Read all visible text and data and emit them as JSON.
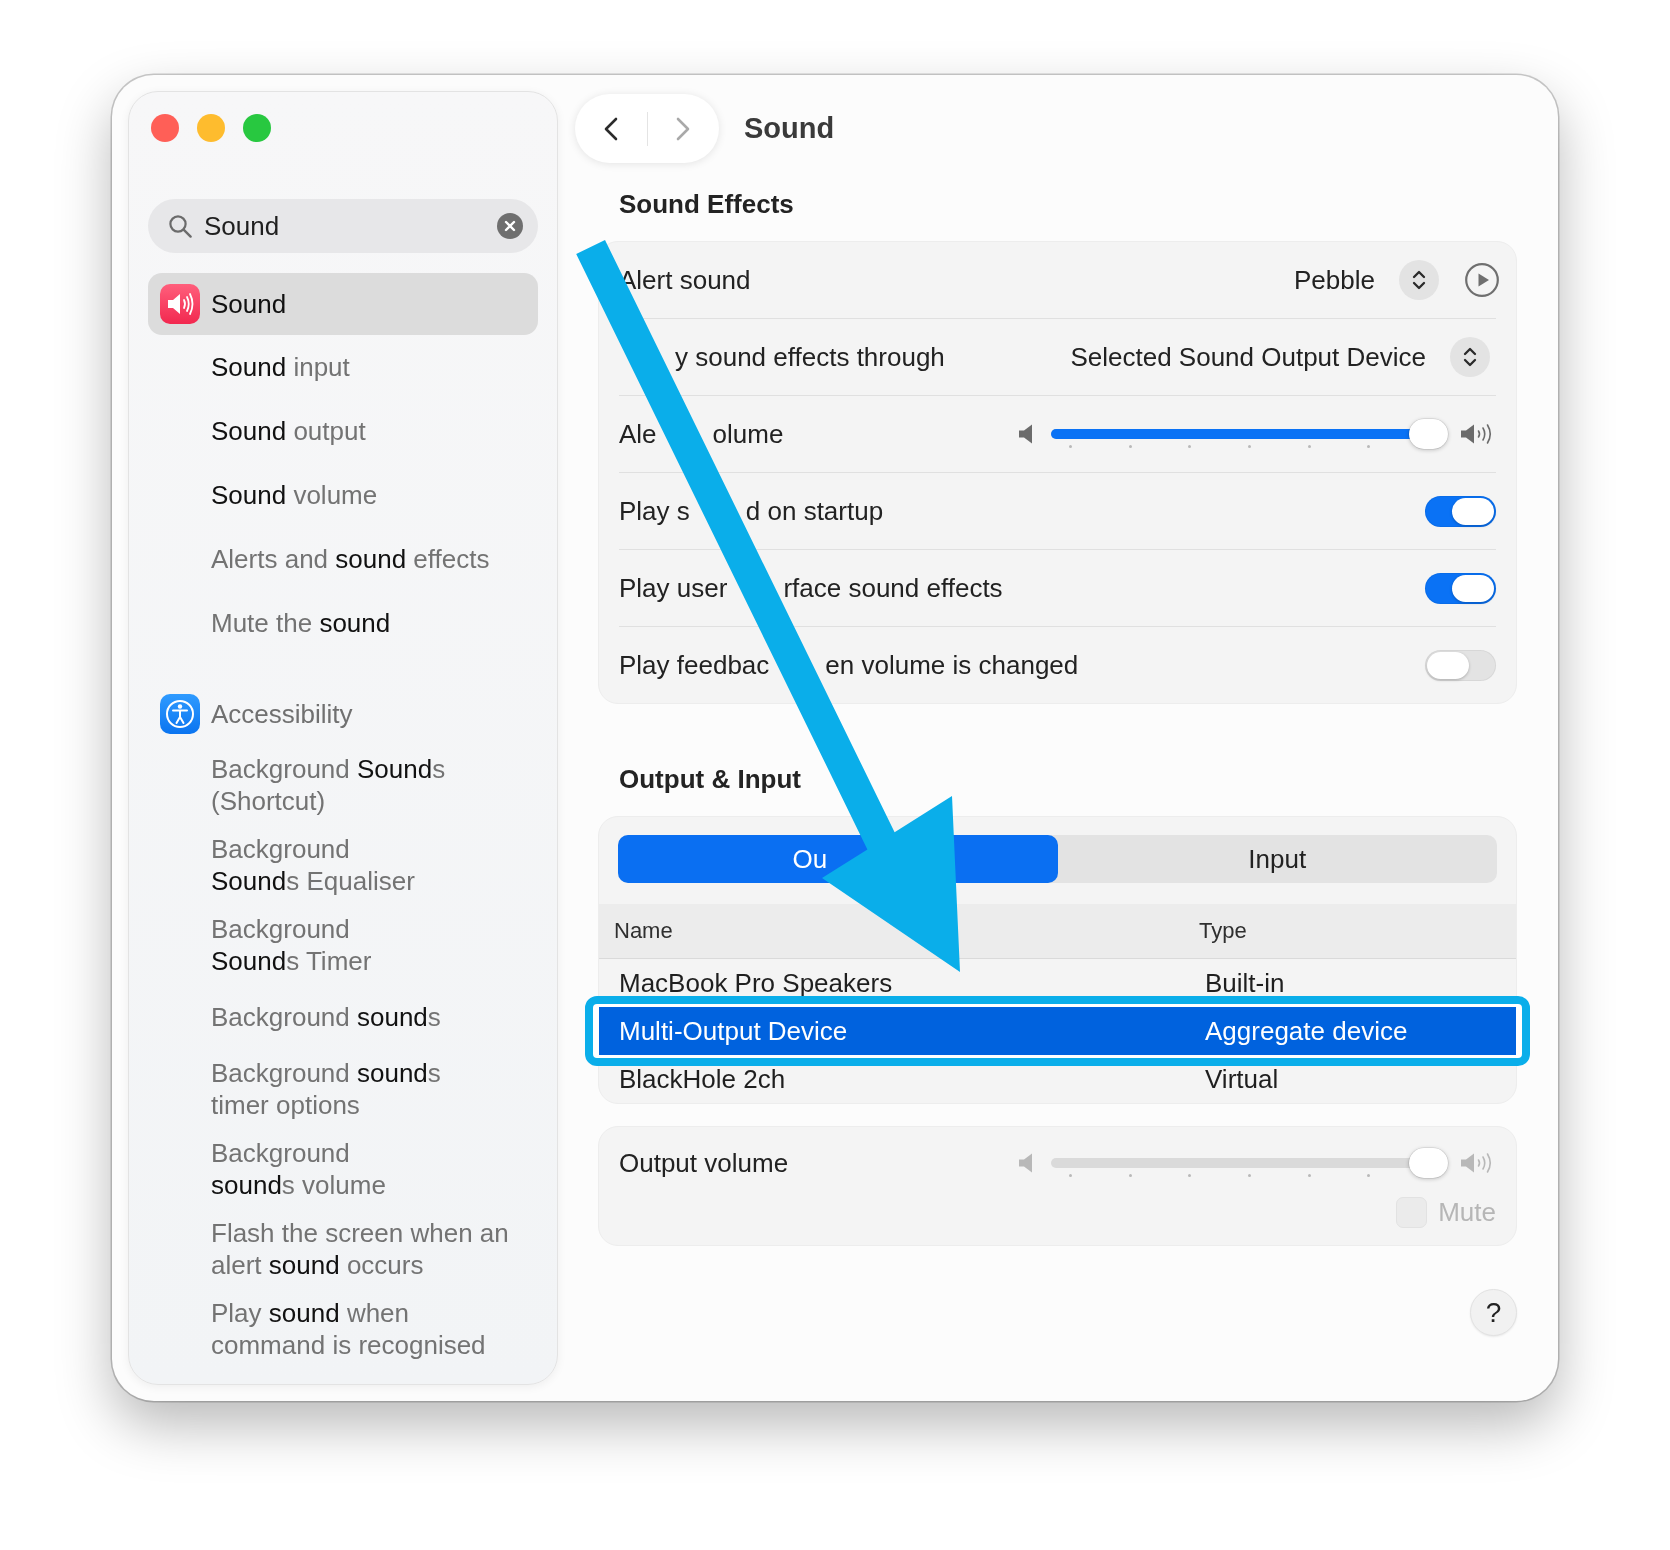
{
  "sidebar": {
    "search": {
      "value": "Sound"
    },
    "results": [
      {
        "label": "Sound",
        "selected": true,
        "children": [
          {
            "text": "**Sound** input",
            "selected": false
          },
          {
            "text": "**Sound** output",
            "selected": false
          },
          {
            "text": "**Sound** volume",
            "selected": false
          },
          {
            "text": "Alerts and **sound** effects",
            "selected": false
          },
          {
            "text": "Mute the **sound**",
            "selected": false
          }
        ]
      },
      {
        "label": "Accessibility",
        "selected": false,
        "children": [
          {
            "text": "Background **Sound**s\n(Shortcut)",
            "selected": false
          },
          {
            "text": "Background\n**Sound**s Equaliser",
            "selected": false
          },
          {
            "text": "Background\n**Sound**s Timer",
            "selected": false
          },
          {
            "text": "Background **sound**s",
            "selected": false
          },
          {
            "text": "Background **sound**s\ntimer options",
            "selected": false
          },
          {
            "text": "Background\n**sound**s volume",
            "selected": false
          },
          {
            "text": "Flash the screen when an\nalert **sound** occurs",
            "selected": false
          },
          {
            "text": "Play **sound** when\ncommand is recognised",
            "selected": false
          }
        ]
      }
    ]
  },
  "header": {
    "nav": [
      {
        "disabled": false
      },
      {
        "disabled": true
      }
    ],
    "title": "Sound"
  },
  "sound_effects": {
    "title": "Sound Effects",
    "rows": [
      {
        "kind": "sound_picker",
        "label": "Alert sound",
        "value": "Pebble"
      },
      {
        "kind": "popup",
        "label_end": "y sound effects through",
        "value": "Selected Sound Output Device"
      },
      {
        "kind": "slider",
        "label_start": "Ale",
        "label_end": "olume",
        "level": 1
      },
      {
        "kind": "toggle",
        "label_start": "Play s",
        "label_end": "d on startup",
        "on": true
      },
      {
        "kind": "toggle",
        "label_start": "Play user",
        "label_end": "rface sound effects",
        "on": true
      },
      {
        "kind": "toggle",
        "label_start": "Play feedbac",
        "label_end": "en volume is changed",
        "on": false
      }
    ]
  },
  "output_input": {
    "title": "Output & Input",
    "tabs": [
      {
        "label_start": "Ou",
        "selected": true
      },
      {
        "label": "Input",
        "selected": false
      }
    ],
    "table": {
      "columns": [
        "Name",
        "Type"
      ],
      "rows": [
        {
          "cells": [
            "MacBook Pro Speakers",
            "Built-in"
          ],
          "selected": false
        },
        {
          "cells": [
            "Multi-Output Device",
            "Aggregate device"
          ],
          "selected": true
        },
        {
          "cells": [
            "BlackHole 2ch",
            "Virtual"
          ],
          "selected": false
        }
      ]
    }
  },
  "output_volume": {
    "label": "Output volume",
    "level": 1,
    "disabled": true,
    "mute": {
      "label": "Mute",
      "checked": false,
      "disabled": true
    }
  },
  "help_button": "?"
}
